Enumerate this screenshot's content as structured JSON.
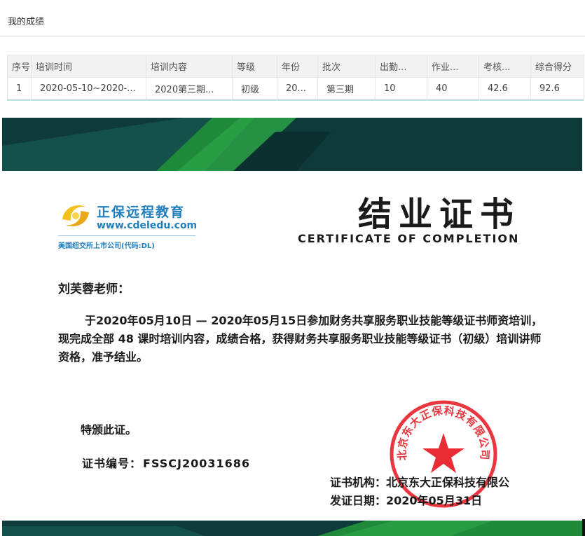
{
  "page": {
    "title": "我的成绩"
  },
  "table": {
    "columns": [
      "序号",
      "培训时间",
      "培训内容",
      "等级",
      "年份",
      "批次",
      "出勤...",
      "作业...",
      "考核...",
      "综合得分"
    ],
    "rows": [
      [
        "1",
        "2020-05-10~2020-...",
        "2020第三期...",
        "初级",
        "20...",
        "第三期",
        "10",
        "40",
        "42.6",
        "92.6"
      ]
    ]
  },
  "certificate": {
    "logo": {
      "name": "正保远程教育",
      "url": "www.cdeledu.com",
      "subtitle": "美国纽交所上市公司(代码:DL)"
    },
    "title": "结业证书",
    "subtitle": "CERTIFICATE OF COMPLETION",
    "recipient": "刘芙蓉老师：",
    "body": "于2020年05月10日 — 2020年05月15日参加财务共享服务职业技能等级证书师资培训，现完成全部 48 课时培训内容，成绩合格，获得财务共享服务职业技能等级证书（初级）培训讲师资格，准予结业。",
    "special_note": "特颁此证。",
    "number_label": "证书编号：",
    "number_value": "FSSCJ20031686",
    "issuer_label": "证书机构：",
    "issuer_value": "北京东大正保科技有限公",
    "date_label": "发证日期：",
    "date_value": "2020年05月31日",
    "seal_text": "北京东大正保科技有限公司"
  },
  "colors": {
    "band_dark": "#0f3a3a",
    "band_green": "#1f8a3a",
    "logo_blue": "#1f7fbf",
    "seal_red": "#e8202a"
  }
}
